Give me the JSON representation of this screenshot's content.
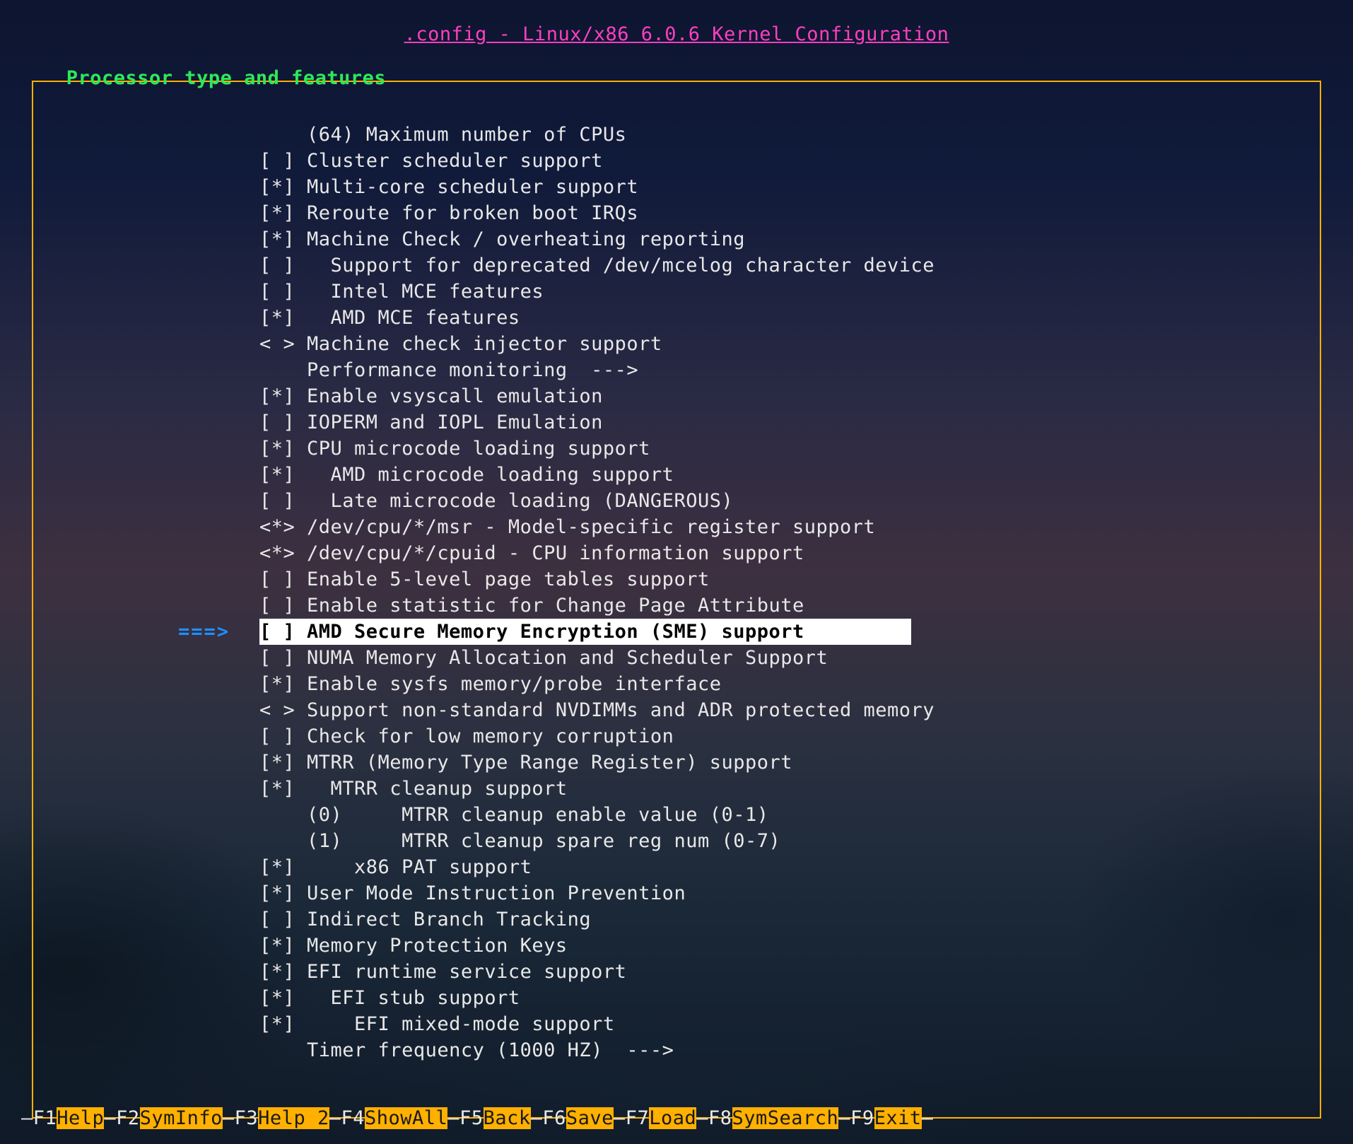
{
  "title": ".config - Linux/x86 6.0.6 Kernel Configuration",
  "section_heading": " Processor type and features ",
  "selection_arrow": "===>",
  "selected_index": 19,
  "items": [
    {
      "marker": "    ",
      "indent": 0,
      "label": "(64) Maximum number of CPUs"
    },
    {
      "marker": "[ ] ",
      "indent": 0,
      "label": "Cluster scheduler support"
    },
    {
      "marker": "[*] ",
      "indent": 0,
      "label": "Multi-core scheduler support"
    },
    {
      "marker": "[*] ",
      "indent": 0,
      "label": "Reroute for broken boot IRQs"
    },
    {
      "marker": "[*] ",
      "indent": 0,
      "label": "Machine Check / overheating reporting"
    },
    {
      "marker": "[ ] ",
      "indent": 1,
      "label": "Support for deprecated /dev/mcelog character device"
    },
    {
      "marker": "[ ] ",
      "indent": 1,
      "label": "Intel MCE features"
    },
    {
      "marker": "[*] ",
      "indent": 1,
      "label": "AMD MCE features"
    },
    {
      "marker": "< > ",
      "indent": 0,
      "label": "Machine check injector support"
    },
    {
      "marker": "    ",
      "indent": 0,
      "label": "Performance monitoring  --->"
    },
    {
      "marker": "[*] ",
      "indent": 0,
      "label": "Enable vsyscall emulation"
    },
    {
      "marker": "[ ] ",
      "indent": 0,
      "label": "IOPERM and IOPL Emulation"
    },
    {
      "marker": "[*] ",
      "indent": 0,
      "label": "CPU microcode loading support"
    },
    {
      "marker": "[*] ",
      "indent": 1,
      "label": "AMD microcode loading support"
    },
    {
      "marker": "[ ] ",
      "indent": 1,
      "label": "Late microcode loading (DANGEROUS)"
    },
    {
      "marker": "<*> ",
      "indent": 0,
      "label": "/dev/cpu/*/msr - Model-specific register support"
    },
    {
      "marker": "<*> ",
      "indent": 0,
      "label": "/dev/cpu/*/cpuid - CPU information support"
    },
    {
      "marker": "[ ] ",
      "indent": 0,
      "label": "Enable 5-level page tables support"
    },
    {
      "marker": "[ ] ",
      "indent": 0,
      "label": "Enable statistic for Change Page Attribute"
    },
    {
      "marker": "[ ] ",
      "indent": 0,
      "label": "AMD Secure Memory Encryption (SME) support         "
    },
    {
      "marker": "[ ] ",
      "indent": 0,
      "label": "NUMA Memory Allocation and Scheduler Support"
    },
    {
      "marker": "[*] ",
      "indent": 0,
      "label": "Enable sysfs memory/probe interface"
    },
    {
      "marker": "< > ",
      "indent": 0,
      "label": "Support non-standard NVDIMMs and ADR protected memory"
    },
    {
      "marker": "[ ] ",
      "indent": 0,
      "label": "Check for low memory corruption"
    },
    {
      "marker": "[*] ",
      "indent": 0,
      "label": "MTRR (Memory Type Range Register) support"
    },
    {
      "marker": "[*] ",
      "indent": 1,
      "label": "MTRR cleanup support"
    },
    {
      "marker": "    ",
      "indent": 0,
      "label": "(0)     MTRR cleanup enable value (0-1)"
    },
    {
      "marker": "    ",
      "indent": 0,
      "label": "(1)     MTRR cleanup spare reg num (0-7)"
    },
    {
      "marker": "[*] ",
      "indent": 2,
      "label": "x86 PAT support"
    },
    {
      "marker": "[*] ",
      "indent": 0,
      "label": "User Mode Instruction Prevention"
    },
    {
      "marker": "[ ] ",
      "indent": 0,
      "label": "Indirect Branch Tracking"
    },
    {
      "marker": "[*] ",
      "indent": 0,
      "label": "Memory Protection Keys"
    },
    {
      "marker": "[*] ",
      "indent": 0,
      "label": "EFI runtime service support"
    },
    {
      "marker": "[*] ",
      "indent": 1,
      "label": "EFI stub support"
    },
    {
      "marker": "[*] ",
      "indent": 2,
      "label": "EFI mixed-mode support"
    },
    {
      "marker": "    ",
      "indent": 0,
      "label": "Timer frequency (1000 HZ)  --->"
    }
  ],
  "fkeys": [
    {
      "key": "F1",
      "label": "Help"
    },
    {
      "key": "F2",
      "label": "SymInfo"
    },
    {
      "key": "F3",
      "label": "Help 2"
    },
    {
      "key": "F4",
      "label": "ShowAll"
    },
    {
      "key": "F5",
      "label": "Back"
    },
    {
      "key": "F6",
      "label": "Save"
    },
    {
      "key": "F7",
      "label": "Load"
    },
    {
      "key": "F8",
      "label": "SymSearch"
    },
    {
      "key": "F9",
      "label": "Exit"
    }
  ]
}
